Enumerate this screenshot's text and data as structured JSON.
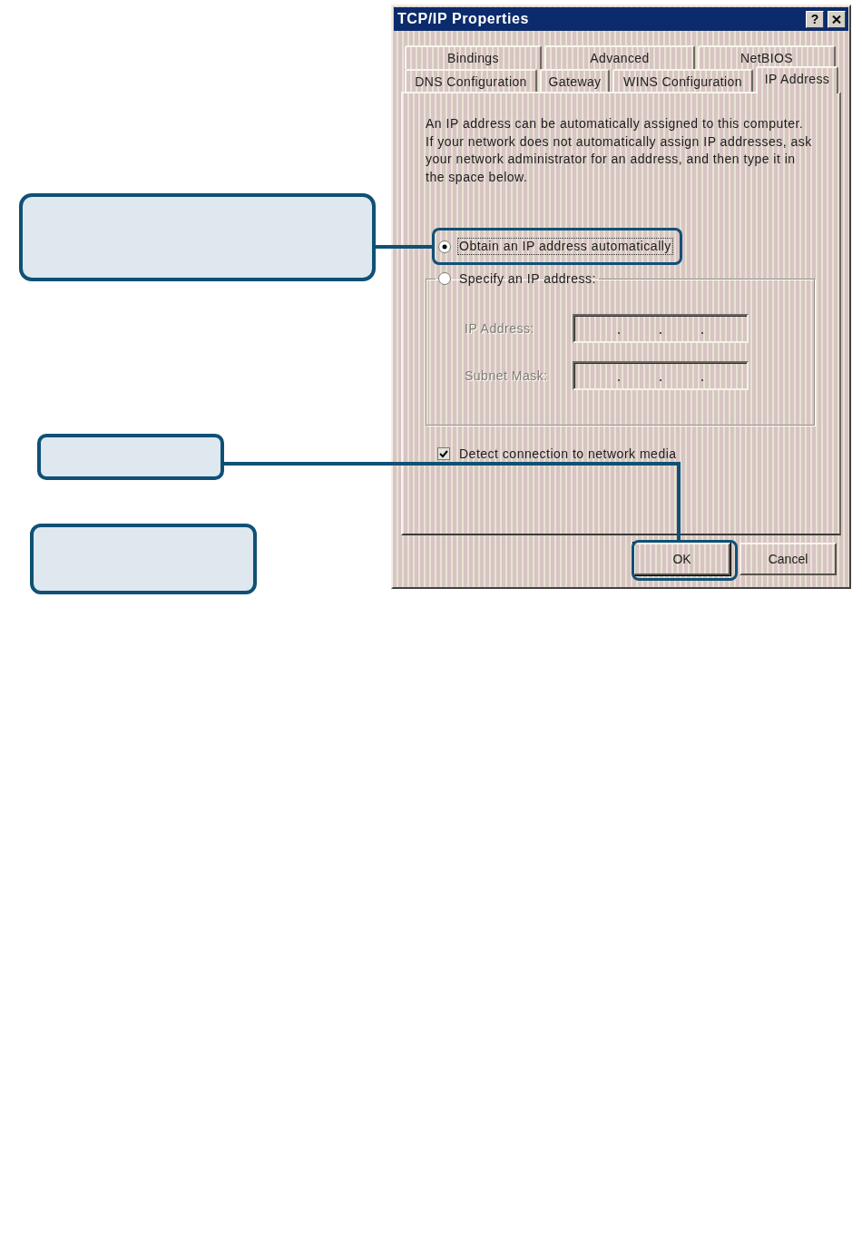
{
  "window": {
    "title": "TCP/IP Properties",
    "title_buttons": [
      {
        "kind": "help",
        "label": "?"
      },
      {
        "kind": "close"
      }
    ]
  },
  "tabs": {
    "rows": [
      [
        {
          "label": "Bindings",
          "selected": false
        },
        {
          "label": "Advanced",
          "selected": false
        },
        {
          "label": "NetBIOS",
          "selected": false
        }
      ],
      [
        {
          "label": "DNS Configuration",
          "selected": false
        },
        {
          "label": "Gateway",
          "selected": false
        },
        {
          "label": "WINS Configuration",
          "selected": false
        },
        {
          "label": "IP Address",
          "selected": true
        }
      ]
    ]
  },
  "description": "An IP address can be automatically assigned to this computer.\nIf your network does not automatically assign IP addresses, ask\nyour network administrator for an address, and then type it in\nthe space below.",
  "ip_mode": {
    "options": [
      {
        "label": "Obtain an IP address automatically",
        "selected": true,
        "focused": true
      },
      {
        "label": "Specify an IP address:",
        "selected": false,
        "focused": false
      }
    ],
    "fields": [
      {
        "label": "IP Address:",
        "disabled": true
      },
      {
        "label": "Subnet Mask:",
        "disabled": true
      }
    ]
  },
  "detect_media": {
    "label": "Detect connection to network media",
    "checked": true
  },
  "buttons": [
    {
      "label": "OK",
      "default": true
    },
    {
      "label": "Cancel",
      "default": false
    }
  ]
}
